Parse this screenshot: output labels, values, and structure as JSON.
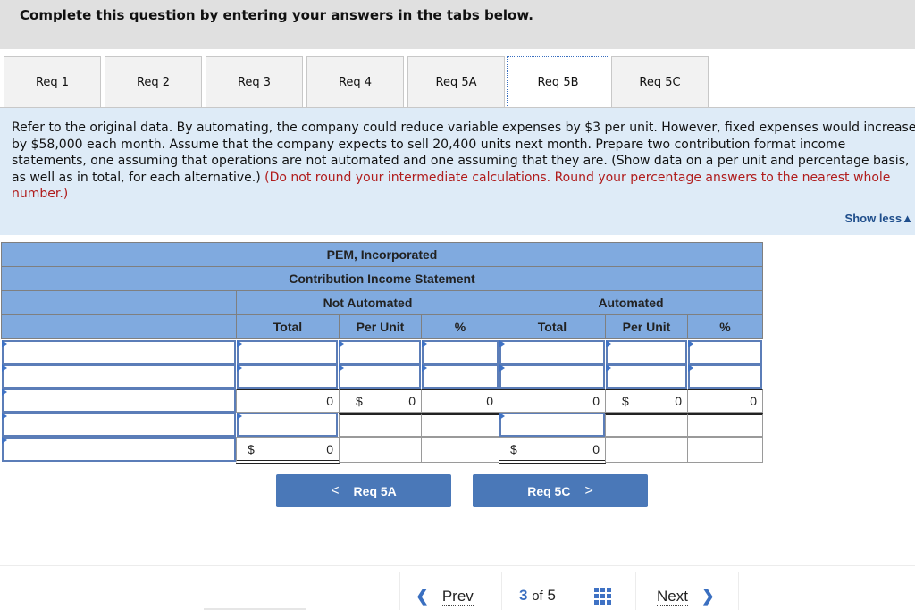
{
  "banner": {
    "title": "Complete this question by entering your answers in the tabs below."
  },
  "tabs": [
    {
      "label": "Req 1",
      "active": false
    },
    {
      "label": "Req 2",
      "active": false
    },
    {
      "label": "Req 3",
      "active": false
    },
    {
      "label": "Req 4",
      "active": false
    },
    {
      "label": "Req 5A",
      "active": false
    },
    {
      "label": "Req 5B",
      "active": true
    },
    {
      "label": "Req 5C",
      "active": false
    }
  ],
  "question": {
    "text": "Refer to the original data. By automating, the company could reduce variable expenses by $3 per unit. However, fixed expenses would increase by $58,000 each month. Assume that the company expects to sell 20,400 units next month. Prepare two contribution format income statements, one assuming that operations are not automated and one assuming that they are. (Show data on a per unit and percentage basis, as well as in total, for each alternative.)",
    "instruction": "(Do not round your intermediate calculations. Round your percentage answers to the nearest whole number.)",
    "show_less": "Show less",
    "show_less_icon": "triangle-up-icon"
  },
  "statement": {
    "company": "PEM, Incorporated",
    "title": "Contribution Income Statement",
    "groups": [
      "Not Automated",
      "Automated"
    ],
    "columns": [
      "Total",
      "Per Unit",
      "%"
    ],
    "rows": [
      {
        "label": "",
        "not_automated": {
          "total": "",
          "per_unit": "",
          "pct": ""
        },
        "automated": {
          "total": "",
          "per_unit": "",
          "pct": ""
        }
      },
      {
        "label": "",
        "not_automated": {
          "total": "",
          "per_unit": "",
          "pct": ""
        },
        "automated": {
          "total": "",
          "per_unit": "",
          "pct": ""
        }
      },
      {
        "label": "",
        "not_automated": {
          "total": "0",
          "per_unit_prefix": "$",
          "per_unit": "0",
          "pct": "0"
        },
        "automated": {
          "total": "0",
          "per_unit_prefix": "$",
          "per_unit": "0",
          "pct": "0"
        }
      },
      {
        "label": "",
        "not_automated": {
          "total": ""
        },
        "automated": {
          "total": ""
        }
      },
      {
        "label": "",
        "not_automated": {
          "total_prefix": "$",
          "total": "0"
        },
        "automated": {
          "total_prefix": "$",
          "total": "0"
        }
      }
    ]
  },
  "nav": {
    "prev_req": "Req 5A",
    "next_req": "Req 5C",
    "prev_chev": "<",
    "next_chev": ">"
  },
  "footer": {
    "prev": "Prev",
    "next": "Next",
    "current": "3",
    "of": "of",
    "total": "5",
    "grid_icon": "grid-icon"
  }
}
